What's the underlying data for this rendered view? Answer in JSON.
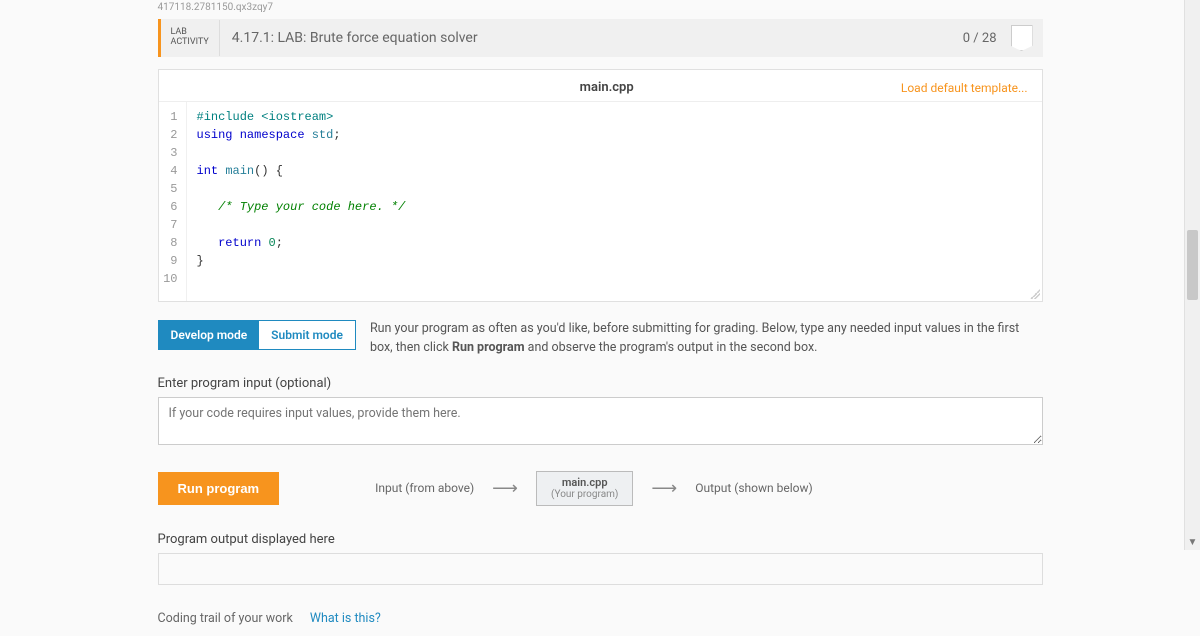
{
  "breadcrumb": "417118.2781150.qx3zqy7",
  "header": {
    "label_line1": "LAB",
    "label_line2": "ACTIVITY",
    "title": "4.17.1: LAB: Brute force equation solver",
    "score": "0 / 28"
  },
  "editor": {
    "filename": "main.cpp",
    "load_template": "Load default template...",
    "lines": [
      "#include <iostream>",
      "using namespace std;",
      "",
      "int main() {",
      "",
      "   /* Type your code here. */",
      "",
      "   return 0;",
      "}",
      ""
    ]
  },
  "modes": {
    "develop": "Develop mode",
    "submit": "Submit mode",
    "help": "Run your program as often as you'd like, before submitting for grading. Below, type any needed input values in the first box, then click ",
    "help_bold": "Run program",
    "help_after": " and observe the program's output in the second box."
  },
  "input": {
    "label": "Enter program input (optional)",
    "placeholder": "If your code requires input values, provide them here."
  },
  "run": {
    "button": "Run program",
    "input_label": "Input (from above)",
    "program_name": "main.cpp",
    "program_sub": "(Your program)",
    "output_label": "Output (shown below)"
  },
  "output": {
    "label": "Program output displayed here"
  },
  "trail": {
    "label": "Coding trail of your work",
    "link": "What is this?"
  }
}
